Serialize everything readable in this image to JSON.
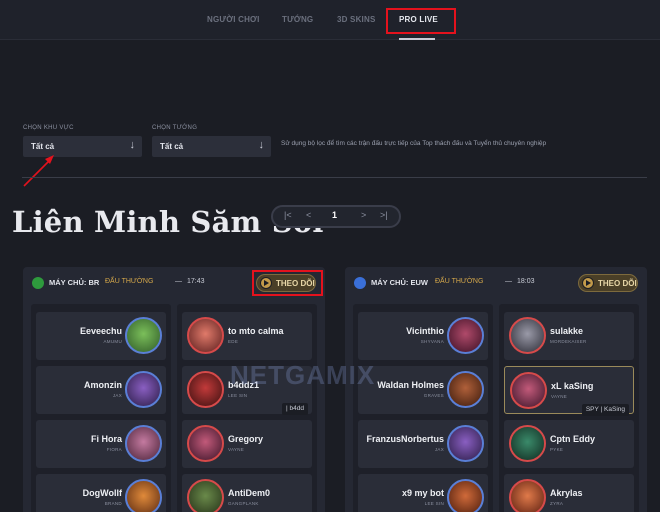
{
  "nav": {
    "tabs": [
      {
        "label": "NGƯỜI CHƠI",
        "active": false
      },
      {
        "label": "TƯỚNG",
        "active": false
      },
      {
        "label": "3D SKINS",
        "active": false
      },
      {
        "label": "PRO LIVE",
        "active": true
      }
    ]
  },
  "filters": {
    "region_label": "CHỌN KHU VỰC",
    "region_value": "Tất cả",
    "champion_label": "CHỌN TƯỚNG",
    "champion_value": "Tất cả",
    "hint": "Sử dụng bộ lọc để tìm các trận đấu trực tiếp của Top thách đấu và Tuyển thủ chuyên nghiệp"
  },
  "watermark_title": "Liên Minh Săm Soi",
  "watermark_logo": "NETGAMIX",
  "pagination": {
    "first": "|<",
    "prev": "<",
    "current": "1",
    "next": ">",
    "last": ">|"
  },
  "matches": [
    {
      "server": "MÁY CHỦ: BR",
      "mode": "ĐẤU THƯỜNG",
      "dash": "—",
      "time": "17:43",
      "follow_label": "THEO DÕI",
      "flag_color": "#2e9a3d",
      "blue_team": [
        {
          "name": "Eeveechu",
          "champion": "AMUMU"
        },
        {
          "name": "Amonzin",
          "champion": "JAX"
        },
        {
          "name": "Fi Hora",
          "champion": "FIORA"
        },
        {
          "name": "DogWollf",
          "champion": "BRAND"
        }
      ],
      "red_team": [
        {
          "name": "to mto calma",
          "champion": "EDE"
        },
        {
          "name": "b4ddz1",
          "champion": "LEE SIN",
          "tag": "| b4dd"
        },
        {
          "name": "Gregory",
          "champion": "VAYNE"
        },
        {
          "name": "AntiDem0",
          "champion": "GANGPLANK"
        }
      ]
    },
    {
      "server": "MÁY CHỦ: EUW",
      "mode": "ĐẤU THƯỜNG",
      "dash": "—",
      "time": "18:03",
      "follow_label": "THEO DÕI",
      "flag_color": "#3a6fd8",
      "blue_team": [
        {
          "name": "Vicinthio",
          "champion": "SHYVANA"
        },
        {
          "name": "Waldan Holmes",
          "champion": "GRAVES"
        },
        {
          "name": "FranzusNorbertus",
          "champion": "JAX"
        },
        {
          "name": "x9 my bot",
          "champion": "LEE SIN"
        }
      ],
      "red_team": [
        {
          "name": "sulakke",
          "champion": "MORDEKAISER"
        },
        {
          "name": "xL kaSing",
          "champion": "VAYNE",
          "tag": "SPY | KaSing"
        },
        {
          "name": "Cptn Eddy",
          "champion": "PYKE"
        },
        {
          "name": "Akrylas",
          "champion": "ZYRA"
        }
      ]
    }
  ],
  "colors": {
    "accent_red": "#e4121d",
    "gold": "#d4a74a",
    "blue_ring": "#5a7fd6",
    "red_ring": "#d64a4a"
  }
}
